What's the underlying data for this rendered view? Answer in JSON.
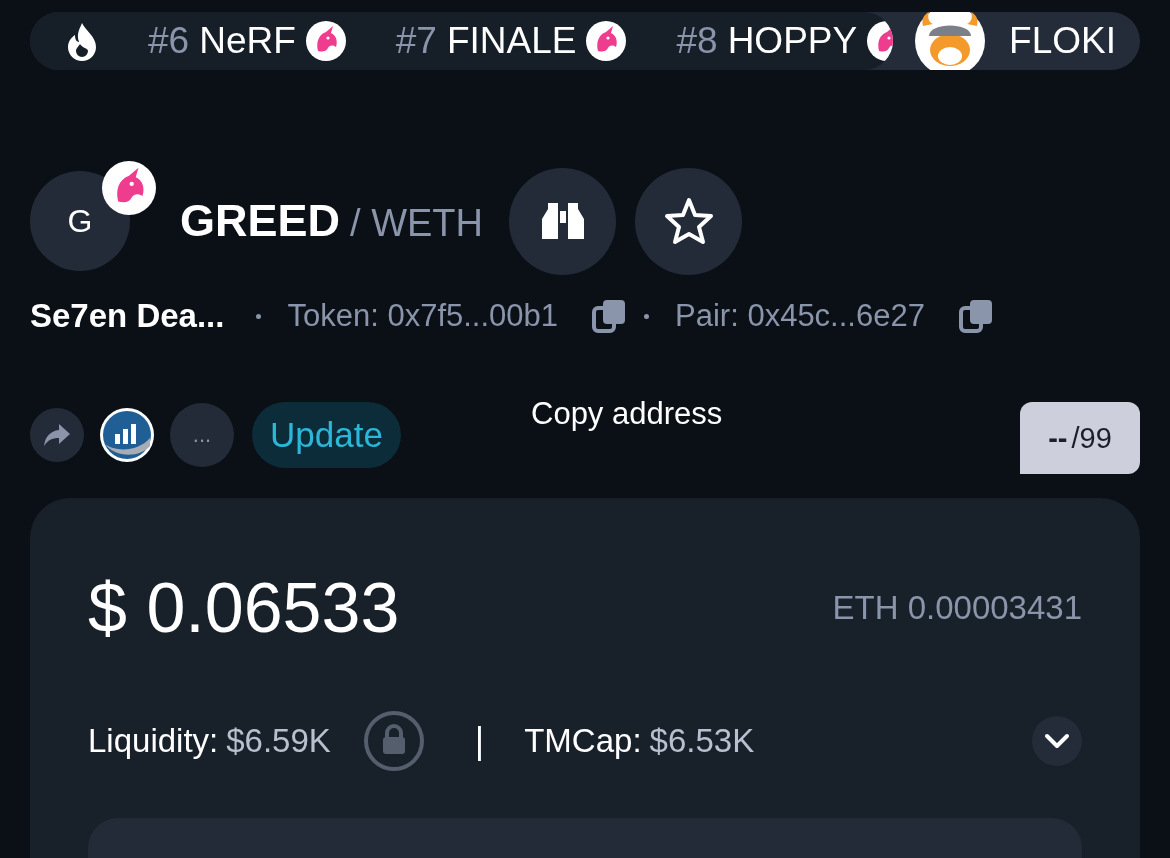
{
  "ticker": {
    "items": [
      {
        "rank": "#6",
        "name": "NeRF"
      },
      {
        "rank": "#7",
        "name": "FINALE"
      },
      {
        "rank": "#8",
        "name": "HOPPY"
      }
    ],
    "featured": {
      "name": "FLOKI"
    }
  },
  "pair": {
    "avatar_letter": "G",
    "base": "GREED",
    "separator": "/",
    "quote": "WETH"
  },
  "info": {
    "name": "Se7en Dea...",
    "token": "Token: 0x7f5...00b1",
    "pair": "Pair: 0x45c...6e27"
  },
  "tooltip": "Copy address",
  "actions": {
    "more": "...",
    "update": "Update"
  },
  "score": {
    "value": "--",
    "max": "/99"
  },
  "price": {
    "usd": "$ 0.06533",
    "eth": "ETH 0.00003431"
  },
  "stats": [
    {
      "label": "Liquidity:",
      "value": "$6.59K",
      "locked": true
    },
    {
      "label": "TMCap:",
      "value": "$6.53K",
      "locked": false
    }
  ],
  "stats_separator": "|"
}
